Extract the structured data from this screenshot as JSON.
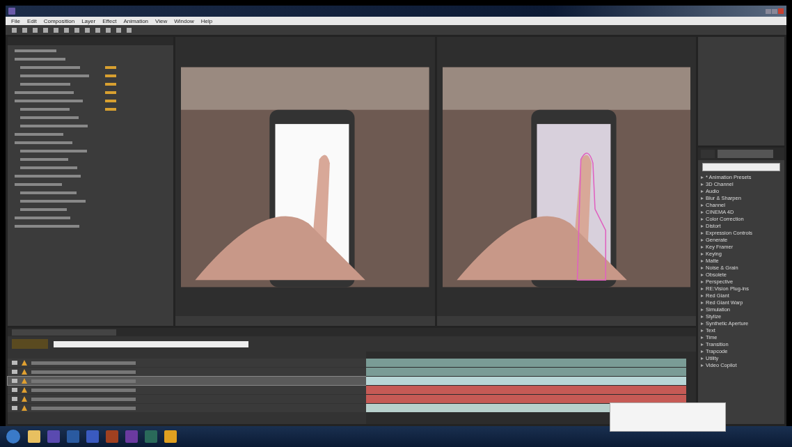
{
  "menu": [
    "File",
    "Edit",
    "Composition",
    "Layer",
    "Effect",
    "Animation",
    "View",
    "Window",
    "Help"
  ],
  "effects_list": {
    "items": [
      "* Animation Presets",
      "3D Channel",
      "Audio",
      "Blur & Sharpen",
      "Channel",
      "CINEMA 4D",
      "Color Correction",
      "Distort",
      "Expression Controls",
      "Generate",
      "Key Framer",
      "Keying",
      "Matte",
      "Noise & Grain",
      "Obsolete",
      "Perspective",
      "RE:Vision Plug-ins",
      "Red Giant",
      "Red Giant Warp",
      "Simulation",
      "Stylize",
      "Synthetic Aperture",
      "Text",
      "Time",
      "Transition",
      "Trapcode",
      "Utility",
      "Video Copilot"
    ]
  },
  "timeline": {
    "layers": [
      {
        "selected": false,
        "color": "#7a9c96"
      },
      {
        "selected": false,
        "color": "#7a9c96"
      },
      {
        "selected": true,
        "color": "#b8d6d6"
      },
      {
        "selected": false,
        "color": "#c65a55"
      },
      {
        "selected": false,
        "color": "#c65a55"
      },
      {
        "selected": false,
        "color": "#b8d0cc"
      }
    ]
  }
}
